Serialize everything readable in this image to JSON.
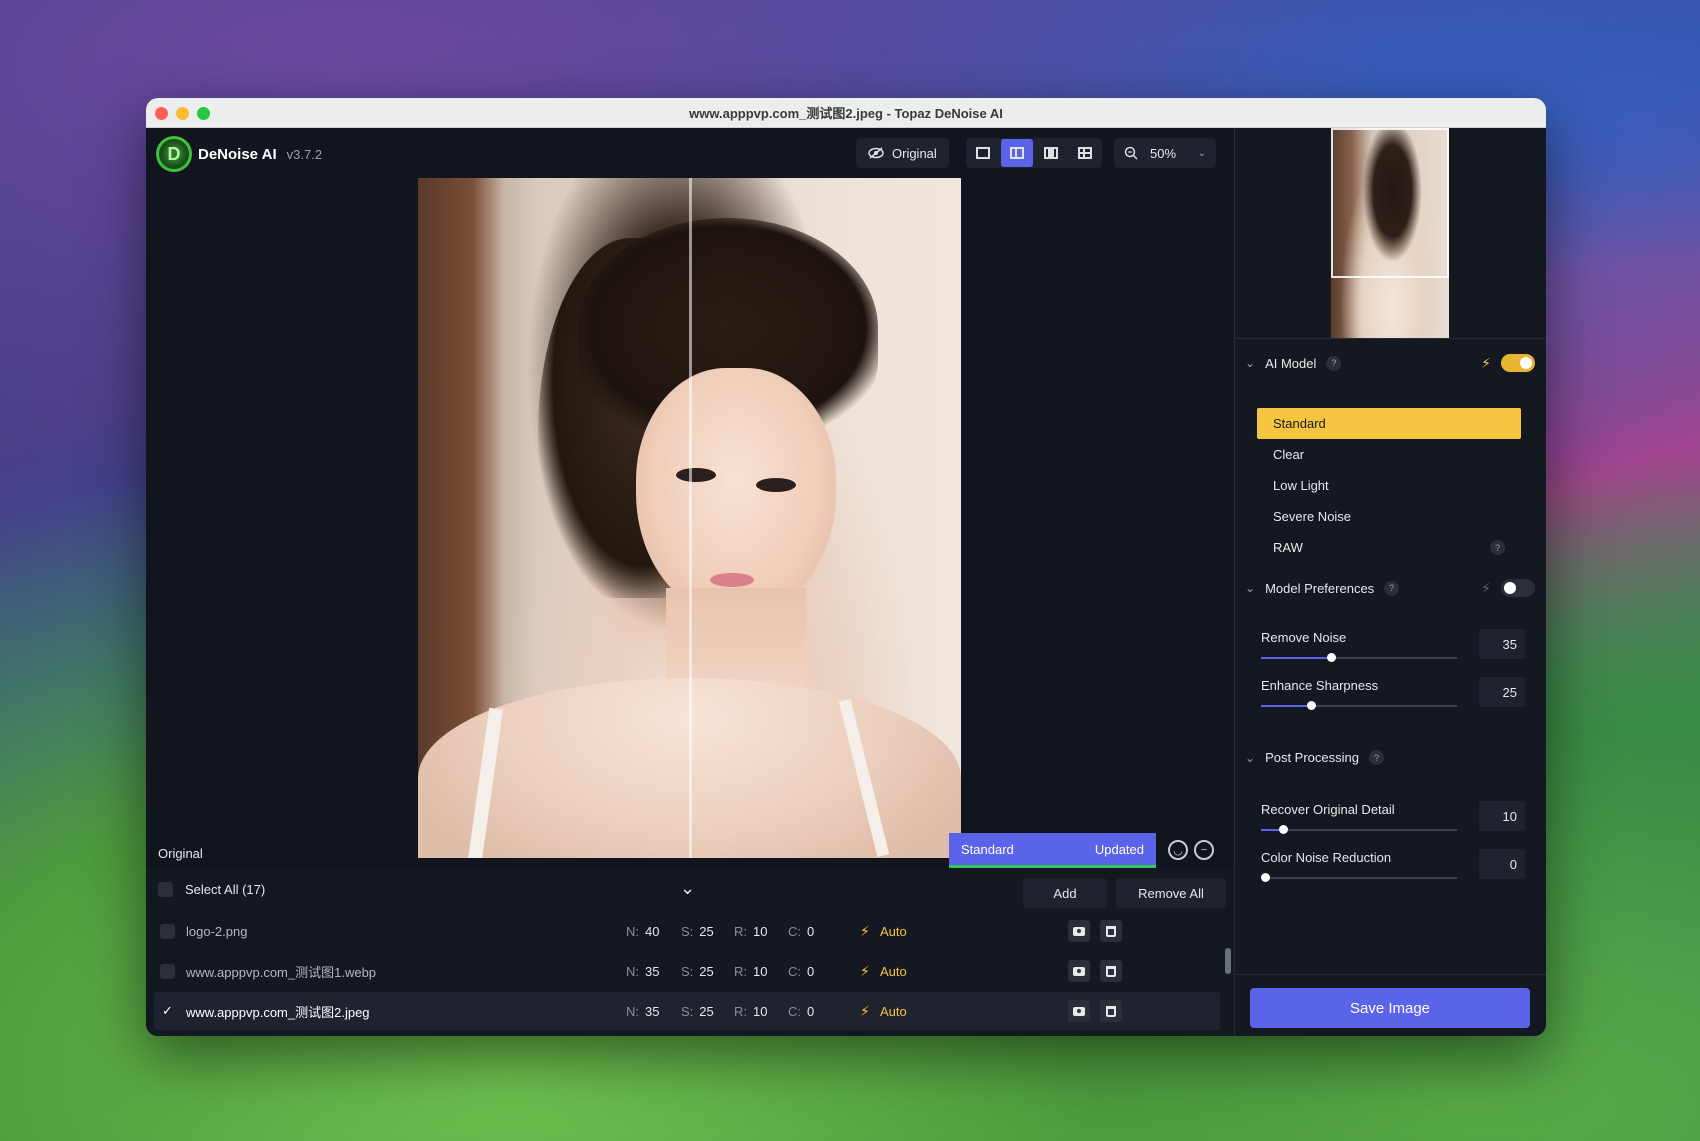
{
  "window": {
    "title": "www.apppvp.com_测试图2.jpeg - Topaz DeNoise AI"
  },
  "app": {
    "logo_letter": "D",
    "name": "DeNoise AI",
    "version": "v3.7.2"
  },
  "toolbar": {
    "original_label": "Original",
    "zoom_value": "50%",
    "view_modes": [
      "single",
      "split",
      "side-by-side",
      "quad"
    ],
    "active_view": "split"
  },
  "preview": {
    "left_label": "Original",
    "model_name": "Standard",
    "model_status": "Updated"
  },
  "file_list": {
    "select_all_label": "Select All (17)",
    "add_label": "Add",
    "remove_all_label": "Remove All",
    "rows": [
      {
        "name": "logo-2.png",
        "n_key": "N:",
        "n": "40",
        "s_key": "S:",
        "s": "25",
        "r_key": "R:",
        "r": "10",
        "c_key": "C:",
        "c": "0",
        "mode": "Auto",
        "selected": false
      },
      {
        "name": "www.apppvp.com_测试图1.webp",
        "n_key": "N:",
        "n": "35",
        "s_key": "S:",
        "s": "25",
        "r_key": "R:",
        "r": "10",
        "c_key": "C:",
        "c": "0",
        "mode": "Auto",
        "selected": false
      },
      {
        "name": "www.apppvp.com_测试图2.jpeg",
        "n_key": "N:",
        "n": "35",
        "s_key": "S:",
        "s": "25",
        "r_key": "R:",
        "r": "10",
        "c_key": "C:",
        "c": "0",
        "mode": "Auto",
        "selected": true
      }
    ]
  },
  "ai_model": {
    "title": "AI Model",
    "help": "?",
    "enabled": true,
    "models": [
      "Standard",
      "Clear",
      "Low Light",
      "Severe Noise",
      "RAW"
    ],
    "selected_model": "Standard"
  },
  "model_preferences": {
    "title": "Model Preferences",
    "help": "?",
    "enabled": false,
    "remove_noise_label": "Remove Noise",
    "remove_noise_value": "35",
    "enhance_sharpness_label": "Enhance Sharpness",
    "enhance_sharpness_value": "25"
  },
  "post_processing": {
    "title": "Post Processing",
    "help": "?",
    "recover_detail_label": "Recover Original Detail",
    "recover_detail_value": "10",
    "color_noise_label": "Color Noise Reduction",
    "color_noise_value": "0"
  },
  "save_label": "Save Image",
  "colors": {
    "accent": "#5b63e8",
    "model_selected": "#f5c542",
    "status_green": "#34c759"
  }
}
